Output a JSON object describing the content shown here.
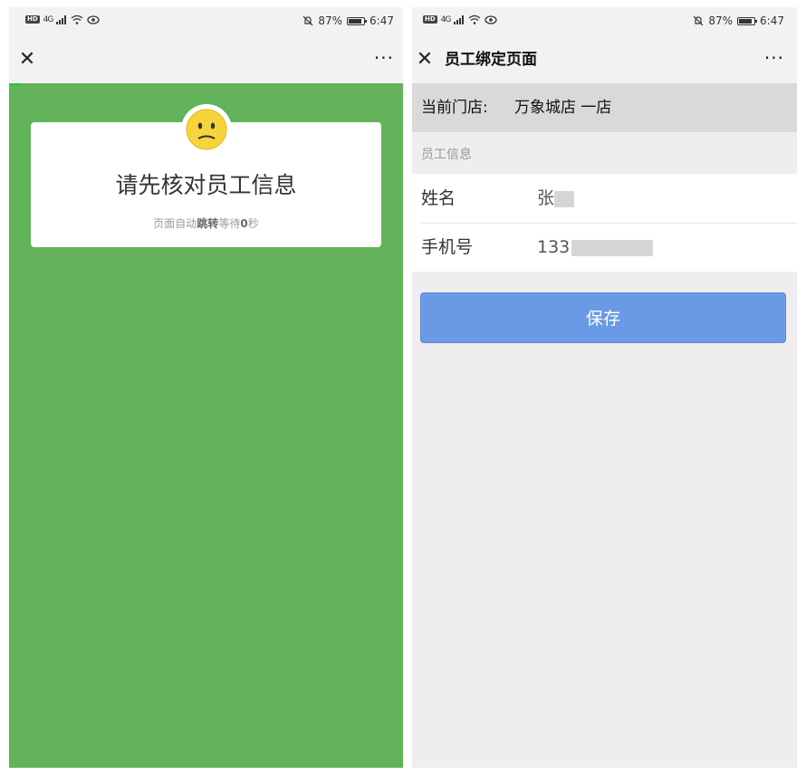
{
  "left_screen": {
    "status": {
      "hd": "HD",
      "network": "4G",
      "battery": "87%",
      "time": "6:47"
    },
    "nav": {
      "close_icon": "close-icon",
      "more_label": "···"
    },
    "colors": {
      "background": "#63b35a",
      "card": "#ffffff"
    },
    "message": {
      "icon": "sad-face-icon",
      "title": "请先核对员工信息",
      "subtitle_prefix": "页面自动",
      "subtitle_bold": "跳转",
      "subtitle_mid": "等待",
      "subtitle_count": "0",
      "subtitle_suffix": "秒"
    }
  },
  "right_screen": {
    "status": {
      "hd": "HD",
      "network": "4G",
      "battery": "87%",
      "time": "6:47"
    },
    "nav": {
      "close_icon": "close-icon",
      "title": "员工绑定页面",
      "more_label": "···"
    },
    "store": {
      "label": "当前门店:",
      "value": "万象城店 一店"
    },
    "section_title": "员工信息",
    "form": {
      "name_label": "姓名",
      "name_value": "张",
      "phone_label": "手机号",
      "phone_value": "133"
    },
    "save_button": "保存",
    "colors": {
      "button": "#6a99e6",
      "store_bar": "#d9d9d9"
    }
  }
}
